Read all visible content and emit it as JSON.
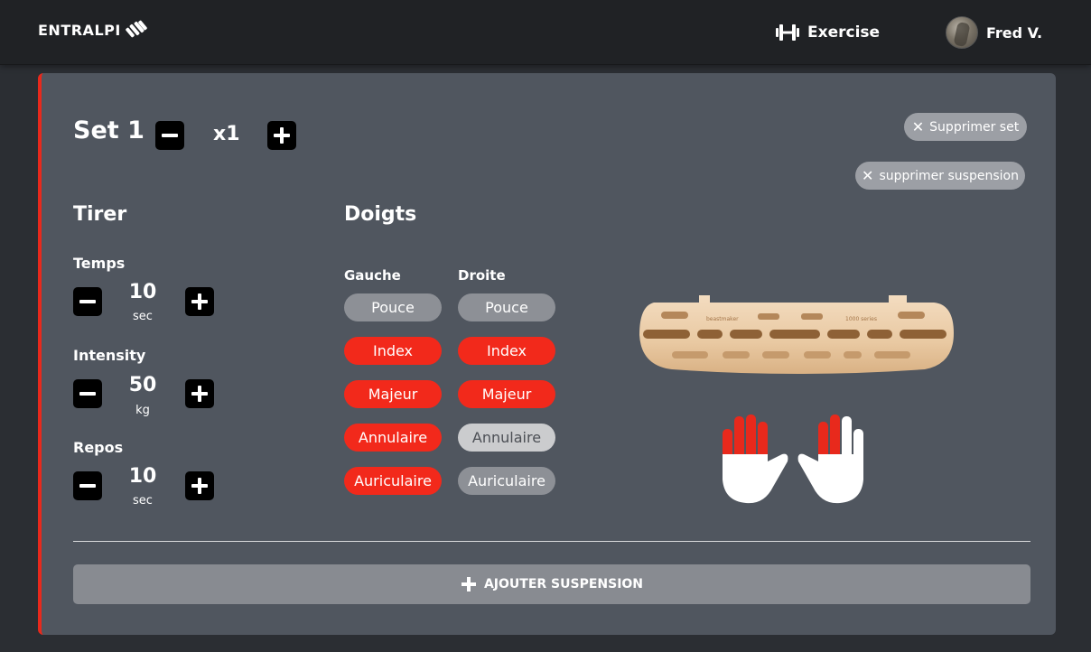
{
  "header": {
    "logo_text": "ENTRALPI",
    "nav_exercise": "Exercise",
    "user_name": "Fred V."
  },
  "set": {
    "title": "Set 1",
    "count": "x1",
    "delete_set": "Supprimer set",
    "delete_suspension": "supprimer suspension"
  },
  "tirer": {
    "title": "Tirer",
    "params": [
      {
        "label": "Temps",
        "value": "10",
        "unit": "sec"
      },
      {
        "label": "Intensity",
        "value": "50",
        "unit": "kg"
      },
      {
        "label": "Repos",
        "value": "10",
        "unit": "sec"
      }
    ]
  },
  "doigts": {
    "title": "Doigts",
    "left_header": "Gauche",
    "right_header": "Droite",
    "left": [
      {
        "label": "Pouce",
        "state": "off"
      },
      {
        "label": "Index",
        "state": "on"
      },
      {
        "label": "Majeur",
        "state": "on"
      },
      {
        "label": "Annulaire",
        "state": "on"
      },
      {
        "label": "Auriculaire",
        "state": "on"
      }
    ],
    "right": [
      {
        "label": "Pouce",
        "state": "off"
      },
      {
        "label": "Index",
        "state": "on"
      },
      {
        "label": "Majeur",
        "state": "on"
      },
      {
        "label": "Annulaire",
        "state": "off-light"
      },
      {
        "label": "Auriculaire",
        "state": "off"
      }
    ]
  },
  "hangboard": {
    "brand_text": "beastmaker",
    "model_text": "1000 series"
  },
  "add_button": "AJOUTER SUSPENSION",
  "colors": {
    "accent_red": "#f2291b",
    "card_bg": "#50565f",
    "topbar_bg": "#202225"
  }
}
